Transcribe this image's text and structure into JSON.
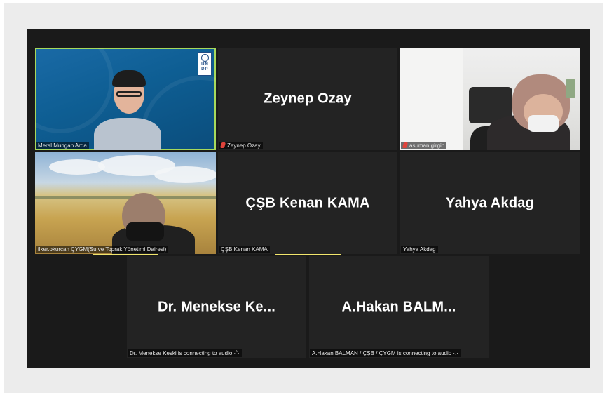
{
  "participants": {
    "meral": {
      "label": "Meral Mungan Arda",
      "logo_letters": [
        "U",
        "N",
        "D",
        "P"
      ]
    },
    "zeynep": {
      "big_name": "Zeynep Ozay",
      "label": "Zeynep Ozay"
    },
    "asuman": {
      "label": "asuman.girgin"
    },
    "ilker": {
      "label": "ilker.okurcan ÇYGM(Su ve Toprak Yönetimi Dairesi)"
    },
    "kenan": {
      "big_name": "ÇŞB Kenan KAMA",
      "label": "ÇŞB Kenan KAMA"
    },
    "yahya": {
      "big_name": "Yahya Akdag",
      "label": "Yahya Akdag"
    },
    "menekse": {
      "big_name": "Dr. Menekse  Ke...",
      "label": "Dr. Menekse Keski is connecting to audio ·˚·"
    },
    "hakan": {
      "big_name": "A.Hakan  BALM...",
      "label": "A.Hakan BALMAN / ÇŞB / ÇYGM is connecting to audio ·.·"
    }
  },
  "colors": {
    "active_speaker_border": "#a7d95c",
    "speaking_indicator": "#f2e66d",
    "muted_icon": "#e0433b"
  },
  "icons": {
    "muted": "microphone-muted-icon",
    "logo": "undp-logo"
  }
}
